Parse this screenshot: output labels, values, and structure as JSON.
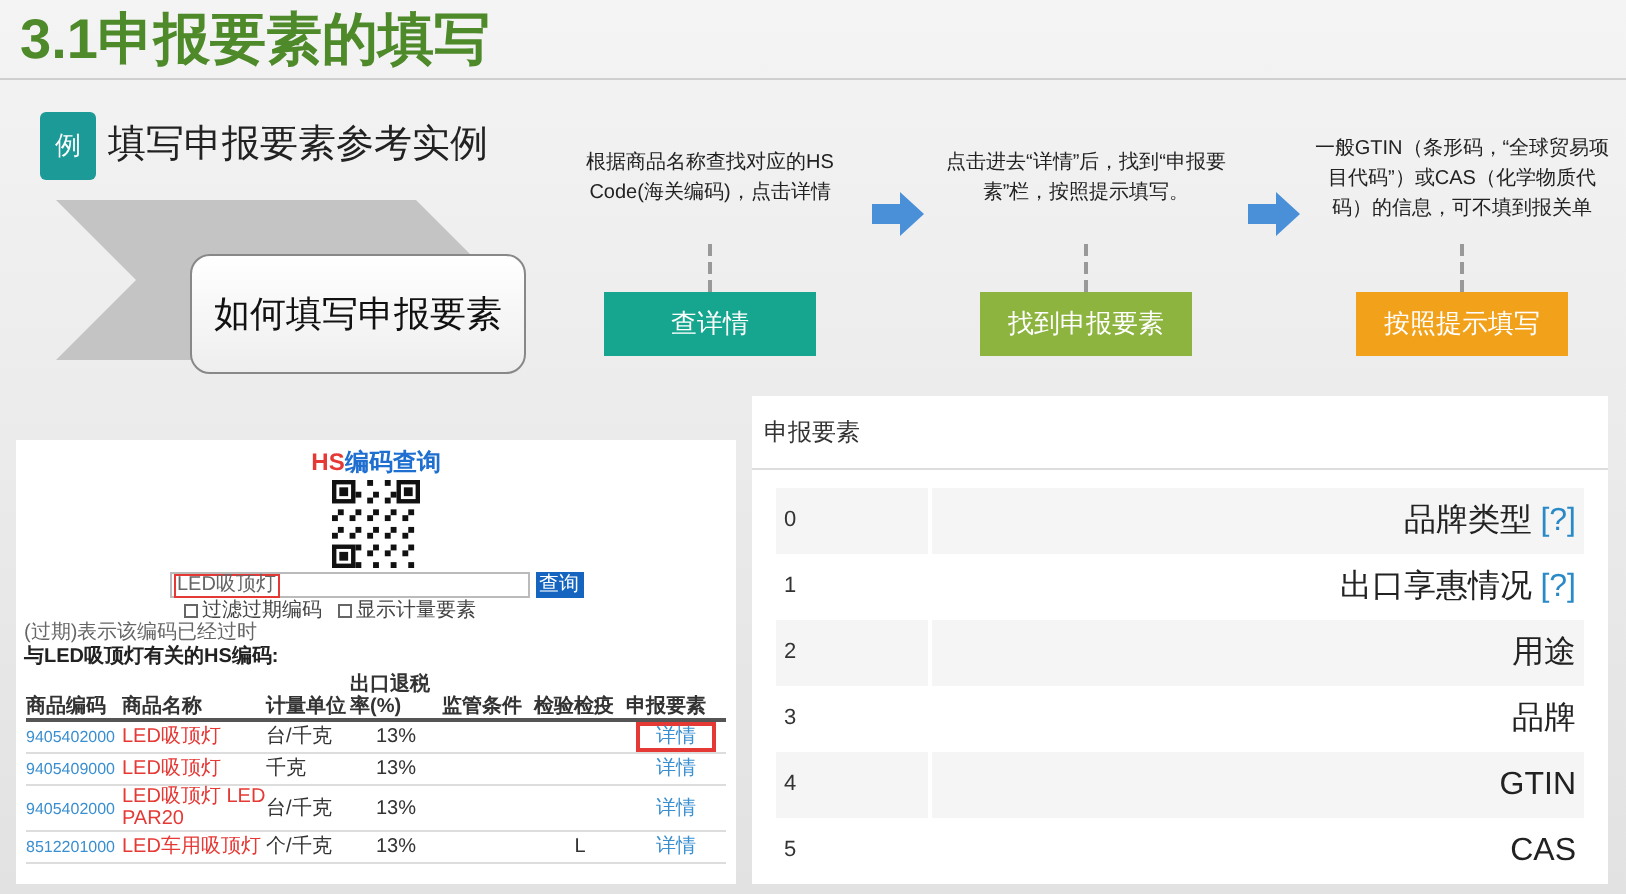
{
  "title": "3.1申报要素的填写",
  "example": {
    "heading": "填写申报要素参考实例",
    "badge": "例",
    "label": "如何填写申报要素"
  },
  "steps": [
    {
      "description": "根据商品名称查找对应的HS Code(海关编码)，点击详情",
      "button": "查详情",
      "color": "#16a68f"
    },
    {
      "description": "点击进去“详情”后，找到“申报要素”栏，按照提示填写。",
      "button": "找到申报要素",
      "color": "#8cb43f"
    },
    {
      "description": "一般GTIN（条形码，“全球贸易项目代码”）或CAS（化学物质代码）的信息，可不填到报关单",
      "button": "按照提示填写",
      "color": "#f2a11a"
    }
  ],
  "hs_query": {
    "title_prefix": "HS",
    "title": "编码查询",
    "search_value": "LED吸顶灯",
    "search_button": "查询",
    "options": [
      {
        "label": "过滤过期编码",
        "checked": false
      },
      {
        "label": "显示计量要素",
        "checked": false
      }
    ],
    "note": "(过期)表示该编码已经过时",
    "results_caption": "与LED吸顶灯有关的HS编码:",
    "columns": [
      "商品编码",
      "商品名称",
      "计量单位",
      "出口退税率(%)",
      "监管条件",
      "检验检疫",
      "申报要素"
    ],
    "rows": [
      {
        "code": "9405402000",
        "name": "LED吸顶灯",
        "unit": "台/千克",
        "rate": "13%",
        "regulation": "",
        "inspection": "",
        "detail": "详情",
        "highlighted": true
      },
      {
        "code": "9405409000",
        "name": "LED吸顶灯",
        "unit": "千克",
        "rate": "13%",
        "regulation": "",
        "inspection": "",
        "detail": "详情",
        "highlighted": false
      },
      {
        "code": "9405402000",
        "name": "LED吸顶灯 LED PAR20",
        "unit": "台/千克",
        "rate": "13%",
        "regulation": "",
        "inspection": "",
        "detail": "详情",
        "highlighted": false
      },
      {
        "code": "8512201000",
        "name": "LED车用吸顶灯",
        "unit": "个/千克",
        "rate": "13%",
        "regulation": "",
        "inspection": "L",
        "detail": "详情",
        "highlighted": false
      }
    ]
  },
  "elements": {
    "title": "申报要素",
    "rows": [
      {
        "index": "0",
        "label": "品牌类型",
        "help": "[?]"
      },
      {
        "index": "1",
        "label": "出口享惠情况",
        "help": "[?]"
      },
      {
        "index": "2",
        "label": "用途"
      },
      {
        "index": "3",
        "label": "品牌"
      },
      {
        "index": "4",
        "label": "GTIN"
      },
      {
        "index": "5",
        "label": "CAS"
      }
    ]
  }
}
